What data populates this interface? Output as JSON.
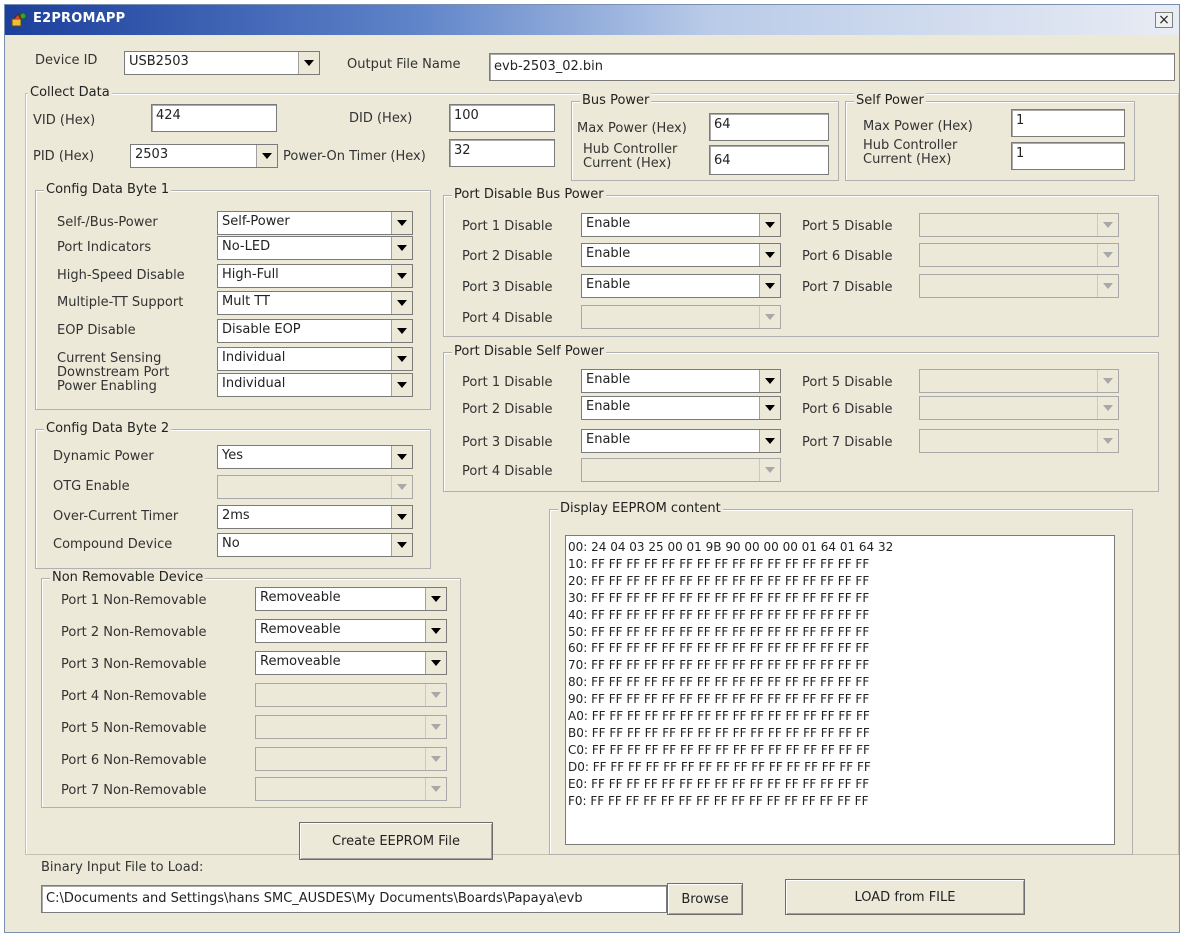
{
  "window": {
    "title": "E2PROMAPP",
    "close_glyph": "×"
  },
  "device_id": {
    "label": "Device ID",
    "value": "USB2503"
  },
  "output_file": {
    "label": "Output File Name",
    "value": "evb-2503_02.bin"
  },
  "collect_data": {
    "title": "Collect Data",
    "vid_label": "VID (Hex)",
    "vid_value": "424",
    "did_label": "DID (Hex)",
    "did_value": "100",
    "pid_label": "PID (Hex)",
    "pid_value": "2503",
    "timer_label": "Power-On Timer (Hex)",
    "timer_value": "32"
  },
  "bus_power": {
    "title": "Bus Power",
    "max_label": "Max Power (Hex)",
    "max_value": "64",
    "hub_label_1": "Hub Controller",
    "hub_label_2": "Current (Hex)",
    "hub_value": "64"
  },
  "self_power": {
    "title": "Self Power",
    "max_label": "Max Power (Hex)",
    "max_value": "1",
    "hub_label_1": "Hub Controller",
    "hub_label_2": "Current (Hex)",
    "hub_value": "1"
  },
  "config1": {
    "title": "Config Data Byte 1",
    "rows": [
      {
        "label": "Self-/Bus-Power",
        "value": "Self-Power"
      },
      {
        "label": "Port Indicators",
        "value": "No-LED"
      },
      {
        "label": "High-Speed Disable",
        "value": "High-Full"
      },
      {
        "label": "Multiple-TT Support",
        "value": "Mult TT"
      },
      {
        "label": "EOP Disable",
        "value": "Disable EOP"
      },
      {
        "label": "Current Sensing",
        "value": "Individual"
      },
      {
        "label": "Downstream Port",
        "label2": "Power Enabling",
        "value": "Individual"
      }
    ]
  },
  "config2": {
    "title": "Config Data Byte 2",
    "rows": [
      {
        "label": "Dynamic Power",
        "value": "Yes"
      },
      {
        "label": "OTG Enable",
        "value": ""
      },
      {
        "label": "Over-Current Timer",
        "value": "2ms"
      },
      {
        "label": "Compound Device",
        "value": "No"
      }
    ]
  },
  "non_removable": {
    "title": "Non Removable Device",
    "rows": [
      {
        "label": "Port 1 Non-Removable",
        "value": "Removeable"
      },
      {
        "label": "Port 2 Non-Removable",
        "value": "Removeable"
      },
      {
        "label": "Port 3 Non-Removable",
        "value": "Removeable"
      },
      {
        "label": "Port 4 Non-Removable",
        "value": ""
      },
      {
        "label": "Port 5 Non-Removable",
        "value": ""
      },
      {
        "label": "Port 6 Non-Removable",
        "value": ""
      },
      {
        "label": "Port 7 Non-Removable",
        "value": ""
      }
    ]
  },
  "port_bus": {
    "title": "Port Disable Bus Power",
    "left": [
      {
        "label": "Port 1 Disable",
        "value": "Enable"
      },
      {
        "label": "Port 2 Disable",
        "value": "Enable"
      },
      {
        "label": "Port 3 Disable",
        "value": "Enable"
      },
      {
        "label": "Port 4 Disable",
        "value": ""
      }
    ],
    "right": [
      {
        "label": "Port 5 Disable",
        "value": ""
      },
      {
        "label": "Port 6 Disable",
        "value": ""
      },
      {
        "label": "Port 7 Disable",
        "value": ""
      }
    ]
  },
  "port_self": {
    "title": "Port Disable Self Power",
    "left": [
      {
        "label": "Port 1 Disable",
        "value": "Enable"
      },
      {
        "label": "Port 2 Disable",
        "value": "Enable"
      },
      {
        "label": "Port 3 Disable",
        "value": "Enable"
      },
      {
        "label": "Port 4 Disable",
        "value": ""
      }
    ],
    "right": [
      {
        "label": "Port 5 Disable",
        "value": ""
      },
      {
        "label": "Port 6 Disable",
        "value": ""
      },
      {
        "label": "Port 7 Disable",
        "value": ""
      }
    ]
  },
  "eeprom": {
    "title": "Display EEPROM content",
    "lines": [
      "00: 24 04 03 25 00 01 9B 90 00 00 00 01 64 01 64 32",
      "10: FF FF FF FF FF FF FF FF FF FF FF FF FF FF FF FF",
      "20: FF FF FF FF FF FF FF FF FF FF FF FF FF FF FF FF",
      "30: FF FF FF FF FF FF FF FF FF FF FF FF FF FF FF FF",
      "40: FF FF FF FF FF FF FF FF FF FF FF FF FF FF FF FF",
      "50: FF FF FF FF FF FF FF FF FF FF FF FF FF FF FF FF",
      "60: FF FF FF FF FF FF FF FF FF FF FF FF FF FF FF FF",
      "70: FF FF FF FF FF FF FF FF FF FF FF FF FF FF FF FF",
      "80: FF FF FF FF FF FF FF FF FF FF FF FF FF FF FF FF",
      "90: FF FF FF FF FF FF FF FF FF FF FF FF FF FF FF FF",
      "A0: FF FF FF FF FF FF FF FF FF FF FF FF FF FF FF FF",
      "B0: FF FF FF FF FF FF FF FF FF FF FF FF FF FF FF FF",
      "C0: FF FF FF FF FF FF FF FF FF FF FF FF FF FF FF FF",
      "D0: FF FF FF FF FF FF FF FF FF FF FF FF FF FF FF FF",
      "E0: FF FF FF FF FF FF FF FF FF FF FF FF FF FF FF FF",
      "F0: FF FF FF FF FF FF FF FF FF FF FF FF FF FF FF FF"
    ]
  },
  "create_button": "Create EEPROM File",
  "binary_input": {
    "label": "Binary Input File to Load:",
    "value": "C:\\Documents and Settings\\hans SMC_AUSDES\\My Documents\\Boards\\Papaya\\evb",
    "browse_label": "Browse"
  },
  "load_button": "LOAD from FILE"
}
